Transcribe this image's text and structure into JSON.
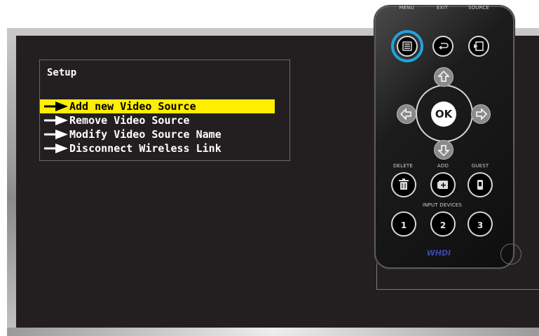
{
  "menu": {
    "title": "Setup",
    "items": [
      {
        "label": "Add new Video Source",
        "selected": true
      },
      {
        "label": "Remove Video Source",
        "selected": false
      },
      {
        "label": "Modify Video Source Name",
        "selected": false
      },
      {
        "label": "Disconnect Wireless Link",
        "selected": false
      }
    ]
  },
  "remote": {
    "menu_label": "MENU",
    "exit_label": "EXIT",
    "source_label": "SOURCE",
    "ok_label": "OK",
    "delete_label": "DELETE",
    "add_label": "ADD",
    "guest_label": "GUEST",
    "input_devices_label": "INPUT DEVICES",
    "input_1": "1",
    "input_2": "2",
    "input_3": "3",
    "brand": "WHDI"
  },
  "colors": {
    "screen": "#231f20",
    "selection": "#ffee00",
    "highlight": "#1fa3e0"
  }
}
